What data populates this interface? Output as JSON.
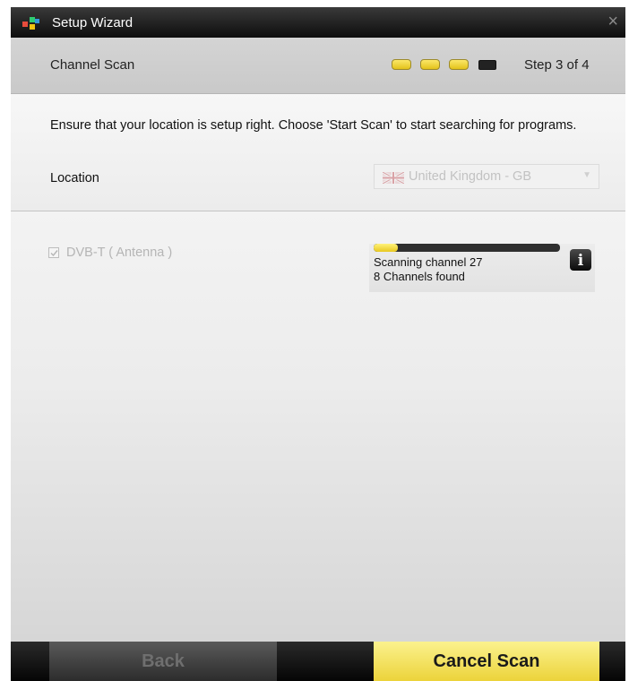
{
  "window": {
    "title": "Setup Wizard",
    "close_glyph": "×",
    "icons": {
      "logo": "app-logo-icon",
      "close": "close-icon"
    }
  },
  "header": {
    "section_title": "Channel Scan",
    "step_label": "Step 3 of 4",
    "steps_total": 4,
    "steps_completed": 3,
    "colors": {
      "step_done": "#f0d43a",
      "step_todo": "#222222"
    }
  },
  "location": {
    "instruction": "Ensure that your location is setup right. Choose 'Start Scan' to start searching for programs.",
    "label": "Location",
    "selected_value": "United Kingdom - GB",
    "flag_icon": "uk-flag-icon"
  },
  "scan": {
    "tuner_label": "DVB-T ( Antenna )",
    "tuner_checked": true,
    "progress_fraction": 0.13,
    "status_text": "Scanning channel 27",
    "channels_found_text": "8 Channels found",
    "info_glyph": "i"
  },
  "footer": {
    "back_label": "Back",
    "cancel_label": "Cancel Scan",
    "colors": {
      "primary": "#f2dd55",
      "secondary": "#4a4a4a"
    }
  }
}
